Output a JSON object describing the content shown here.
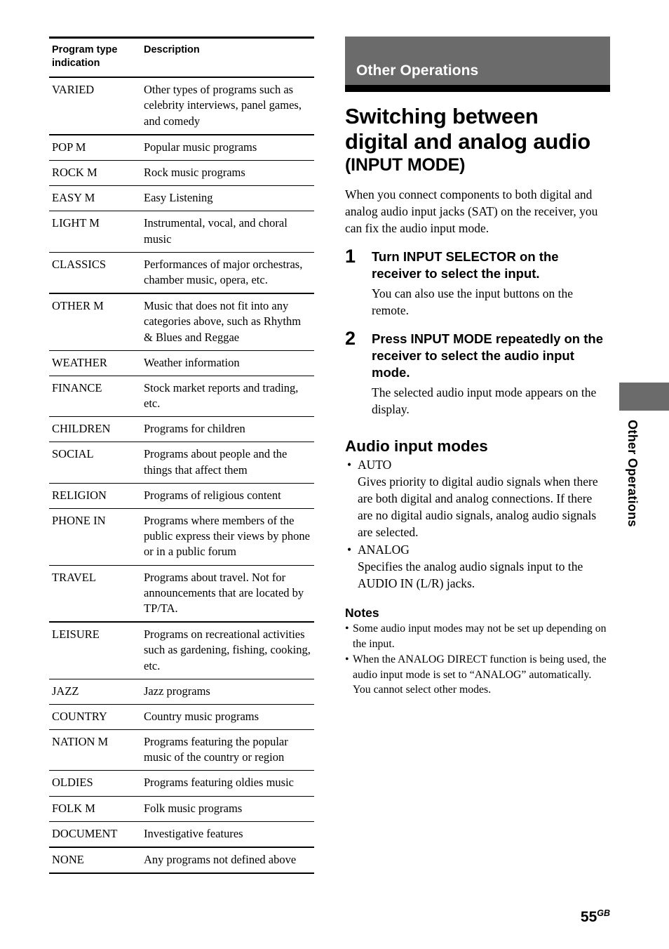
{
  "table": {
    "headers": [
      "Program type\nindication",
      "Description"
    ],
    "header_line1": "Program type",
    "header_line2": "indication",
    "header_desc": "Description",
    "rows": [
      {
        "key": "VARIED",
        "desc": "Other types of programs such as celebrity interviews, panel games, and comedy",
        "thick": true
      },
      {
        "key": "POP M",
        "desc": "Popular music programs",
        "thick": false
      },
      {
        "key": "ROCK M",
        "desc": "Rock music programs",
        "thick": false
      },
      {
        "key": "EASY M",
        "desc": "Easy Listening",
        "thick": false
      },
      {
        "key": "LIGHT M",
        "desc": "Instrumental, vocal, and choral music",
        "thick": false
      },
      {
        "key": "CLASSICS",
        "desc": "Performances of major orchestras, chamber music, opera, etc.",
        "thick": true
      },
      {
        "key": "OTHER M",
        "desc": "Music that does not fit into any categories above, such as Rhythm & Blues and Reggae",
        "thick": false
      },
      {
        "key": "WEATHER",
        "desc": "Weather information",
        "thick": false
      },
      {
        "key": "FINANCE",
        "desc": "Stock market reports and trading, etc.",
        "thick": false
      },
      {
        "key": "CHILDREN",
        "desc": "Programs for children",
        "thick": false
      },
      {
        "key": "SOCIAL",
        "desc": "Programs about people and the things that affect them",
        "thick": false
      },
      {
        "key": "RELIGION",
        "desc": "Programs of religious content",
        "thick": false
      },
      {
        "key": "PHONE IN",
        "desc": "Programs where members of the public express their views by phone or in a public forum",
        "thick": false
      },
      {
        "key": "TRAVEL",
        "desc": "Programs about travel. Not for announcements that are located by TP/TA.",
        "thick": true
      },
      {
        "key": "LEISURE",
        "desc": "Programs on recreational activities such as gardening, fishing, cooking, etc.",
        "thick": false
      },
      {
        "key": "JAZZ",
        "desc": "Jazz programs",
        "thick": false
      },
      {
        "key": "COUNTRY",
        "desc": "Country music programs",
        "thick": false
      },
      {
        "key": "NATION M",
        "desc": "Programs featuring the popular music of the country or region",
        "thick": false
      },
      {
        "key": "OLDIES",
        "desc": "Programs featuring oldies music",
        "thick": false
      },
      {
        "key": "FOLK M",
        "desc": "Folk music programs",
        "thick": false
      },
      {
        "key": "DOCUMENT",
        "desc": "Investigative features",
        "thick": true
      },
      {
        "key": "NONE",
        "desc": "Any programs not defined above",
        "thick": false
      }
    ]
  },
  "section": {
    "band_label": "Other Operations",
    "title_line1": "Switching between",
    "title_line2": "digital and analog audio",
    "title_line3": "(INPUT MODE)"
  },
  "intro": "When you connect components to both digital and analog audio input jacks (SAT) on the receiver, you can fix the audio input mode.",
  "steps": [
    {
      "num": "1",
      "head": "Turn INPUT SELECTOR on the receiver to select the input.",
      "body": "You can also use the input buttons on the remote."
    },
    {
      "num": "2",
      "head": "Press INPUT MODE repeatedly on the receiver to select the audio input mode.",
      "body": "The selected audio input mode appears on the display."
    }
  ],
  "audio_modes": {
    "heading": "Audio input modes",
    "bullet_glyph": "•",
    "items": [
      {
        "name": "AUTO",
        "desc": "Gives priority to digital audio signals when there are both digital and analog connections. If there are no digital audio signals, analog audio signals are selected."
      },
      {
        "name": "ANALOG",
        "desc": "Specifies the analog audio signals input to the AUDIO IN (L/R) jacks."
      }
    ]
  },
  "notes": {
    "heading": "Notes",
    "bullet_glyph": "•",
    "items": [
      "Some audio input modes may not be set up depending on the input.",
      "When the ANALOG DIRECT function is being used, the audio input mode is set to “ANALOG” automatically. You cannot select other modes."
    ]
  },
  "side_tab": {
    "label": "Other Operations"
  },
  "folio": {
    "number": "55",
    "suffix": "GB"
  },
  "colors": {
    "band_gray": "#6b6b6b",
    "rule_black": "#000000",
    "page_background": "#ffffff"
  }
}
